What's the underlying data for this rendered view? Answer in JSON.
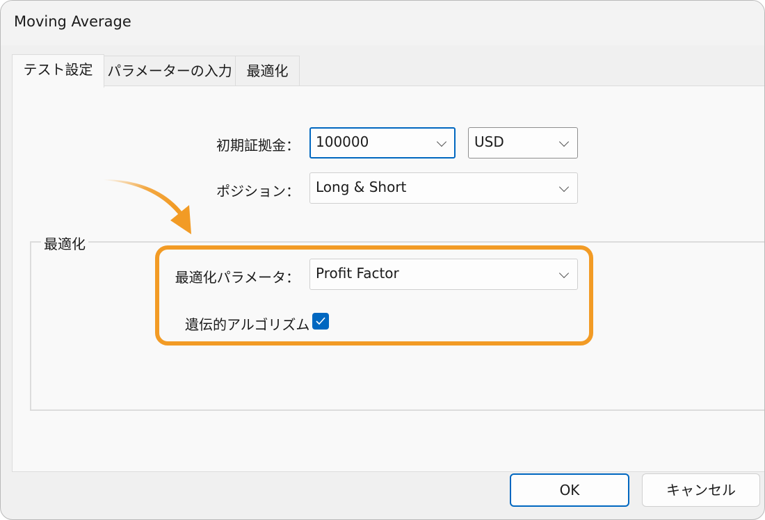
{
  "window": {
    "title": "Moving Average"
  },
  "tabs": [
    {
      "label": "テスト設定",
      "active": true
    },
    {
      "label": "パラメーターの入力",
      "active": false
    },
    {
      "label": "最適化",
      "active": false
    }
  ],
  "test_settings": {
    "initial_deposit": {
      "label": "初期証拠金：",
      "value": "100000",
      "currency": "USD"
    },
    "position": {
      "label": "ポジション：",
      "value": "Long & Short"
    }
  },
  "optimization_group": {
    "title": "最適化",
    "parameter": {
      "label": "最適化パラメータ：",
      "value": "Profit Factor"
    },
    "genetic_algorithm": {
      "label": "遺伝的アルゴリズム",
      "checked": true
    }
  },
  "annotation": {
    "highlight_color": "#f29b25",
    "arrow_icon": "curved-arrow-icon"
  },
  "buttons": {
    "ok": "OK",
    "cancel": "キャンセル"
  },
  "colors": {
    "accent": "#0067c0",
    "highlight": "#f29b25"
  }
}
